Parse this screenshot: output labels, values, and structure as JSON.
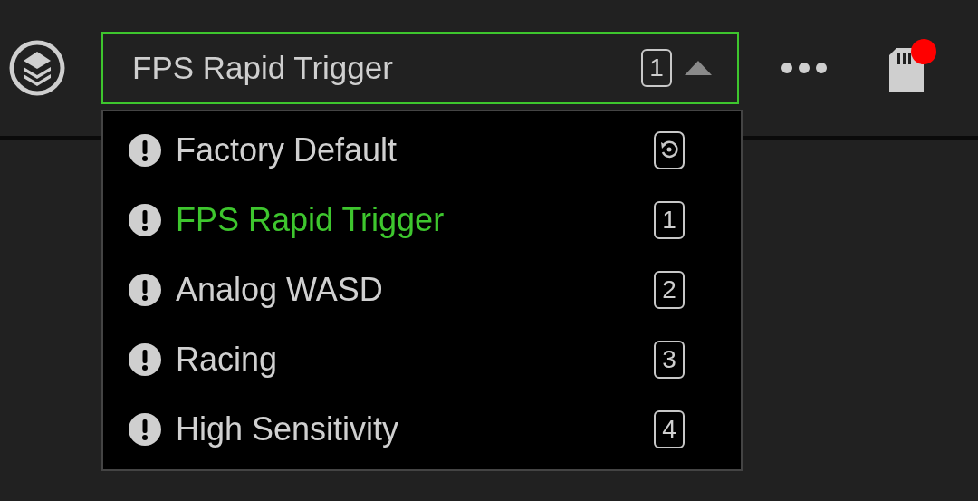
{
  "profile_select": {
    "value": "FPS Rapid Trigger",
    "slot": "1",
    "expanded": true
  },
  "profiles": [
    {
      "name": "Factory Default",
      "kind": "reset",
      "selected": false
    },
    {
      "name": "FPS Rapid Trigger",
      "kind": "slot",
      "slot": "1",
      "selected": true
    },
    {
      "name": "Analog WASD",
      "kind": "slot",
      "slot": "2",
      "selected": false
    },
    {
      "name": "Racing",
      "kind": "slot",
      "slot": "3",
      "selected": false
    },
    {
      "name": "High Sensitivity",
      "kind": "slot",
      "slot": "4",
      "selected": false
    }
  ],
  "storage": {
    "notification": true
  }
}
